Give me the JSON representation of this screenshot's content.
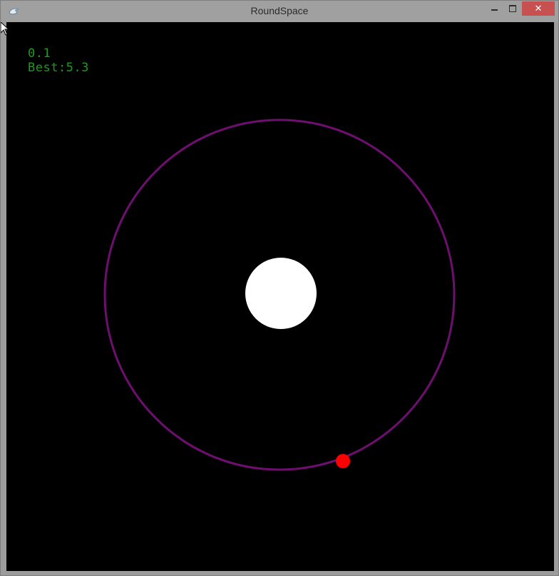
{
  "window": {
    "title": "RoundSpace",
    "icon": "app-icon",
    "controls": {
      "minimize_icon": "minimize-icon",
      "maximize_icon": "maximize-icon",
      "close_label": "✕"
    }
  },
  "hud": {
    "score": "0.1",
    "best": "Best:5.3"
  },
  "colors": {
    "background": "#000000",
    "orbit": "#6e0f70",
    "planet": "#ffffff",
    "player": "#ff0000",
    "hud_text": "#1f9a1f"
  }
}
